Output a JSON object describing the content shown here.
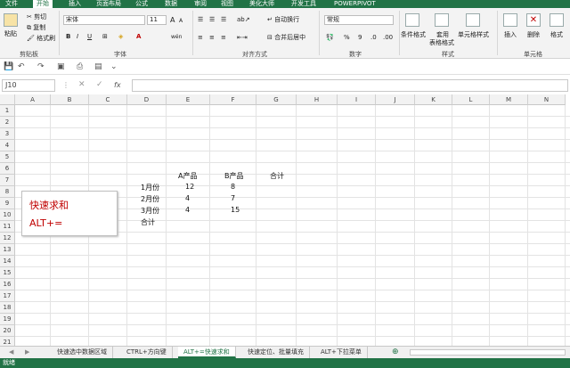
{
  "ribbon_tabs": [
    "文件",
    "开始",
    "插入",
    "页面布局",
    "公式",
    "数据",
    "审阅",
    "视图",
    "美化大师",
    "开发工具",
    "POWERPIVOT"
  ],
  "clipboard": {
    "paste": "粘贴",
    "cut": "剪切",
    "copy": "复制",
    "format_painter": "格式刷",
    "group": "剪贴板"
  },
  "font": {
    "name": "宋体",
    "size": "11",
    "bold": "B",
    "italic": "I",
    "underline": "U",
    "bigger": "A",
    "smaller": "A",
    "wen": "wén",
    "group": "字体"
  },
  "alignment": {
    "wrap": "自动换行",
    "merge": "合并后居中",
    "group": "对齐方式"
  },
  "number": {
    "format": "常规",
    "percent": "%",
    "comma": "9",
    "group": "数字"
  },
  "styles": {
    "conditional": "条件格式",
    "table_line1": "套用",
    "table_line2": "表格格式",
    "cell_styles": "单元格样式",
    "group": "样式"
  },
  "cells": {
    "insert": "插入",
    "delete": "删除",
    "format": "格式",
    "group": "单元格"
  },
  "name_box": "J10",
  "fx": "fx",
  "columns": [
    "A",
    "B",
    "C",
    "D",
    "E",
    "F",
    "G",
    "H",
    "I",
    "J",
    "K",
    "L",
    "M",
    "N"
  ],
  "rows": [
    "1",
    "2",
    "3",
    "4",
    "5",
    "6",
    "7",
    "8",
    "9",
    "10",
    "11",
    "12",
    "13",
    "14",
    "15",
    "16",
    "17",
    "18",
    "19",
    "20",
    "21"
  ],
  "table": {
    "header": [
      "A产品",
      "B产品",
      "合计"
    ],
    "rows": [
      {
        "label": "1月份",
        "a": "12",
        "b": "8"
      },
      {
        "label": "2月份",
        "a": "4",
        "b": "7"
      },
      {
        "label": "3月份",
        "a": "4",
        "b": "15"
      }
    ],
    "total_label": "合计"
  },
  "callout": {
    "line1": "快速求和",
    "line2": "ALT+="
  },
  "sheet_tabs": [
    "快速选中数据区域",
    "CTRL+方向键",
    "ALT+=快速求和",
    "快速定位、批量填充",
    "ALT+下拉菜单"
  ],
  "active_sheet": 2,
  "add_sheet": "⊕",
  "status": "就绪",
  "theme": {
    "accent": "#217346",
    "callout_text": "#c00000"
  }
}
